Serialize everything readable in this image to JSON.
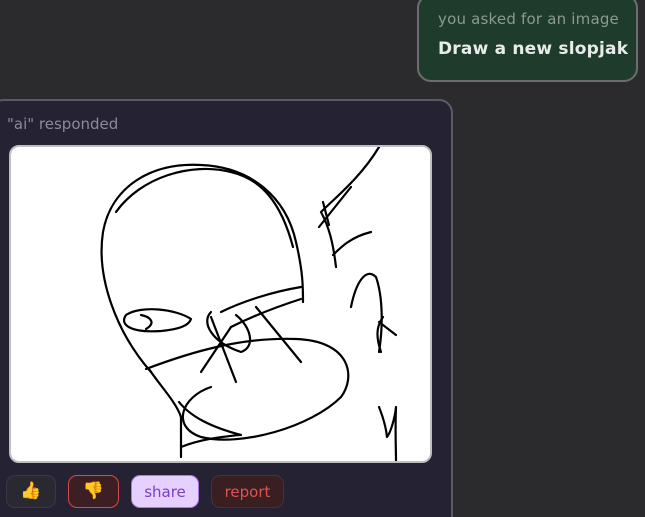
{
  "request": {
    "caption": "you asked for an image",
    "prompt": "Draw a new slopjak"
  },
  "response": {
    "caption": "\"ai\" responded",
    "image_subject": "hand-drawn sketch"
  },
  "actions": {
    "thumbs_up_icon": "thumbs-up-icon",
    "thumbs_down_icon": "thumbs-down-icon",
    "share_label": "share",
    "report_label": "report"
  },
  "colors": {
    "background": "#2b2b2d",
    "request_bubble": "#1f3b2b",
    "response_card": "#252333",
    "share_accent": "#7a3fc4",
    "report_accent": "#e0524e"
  }
}
